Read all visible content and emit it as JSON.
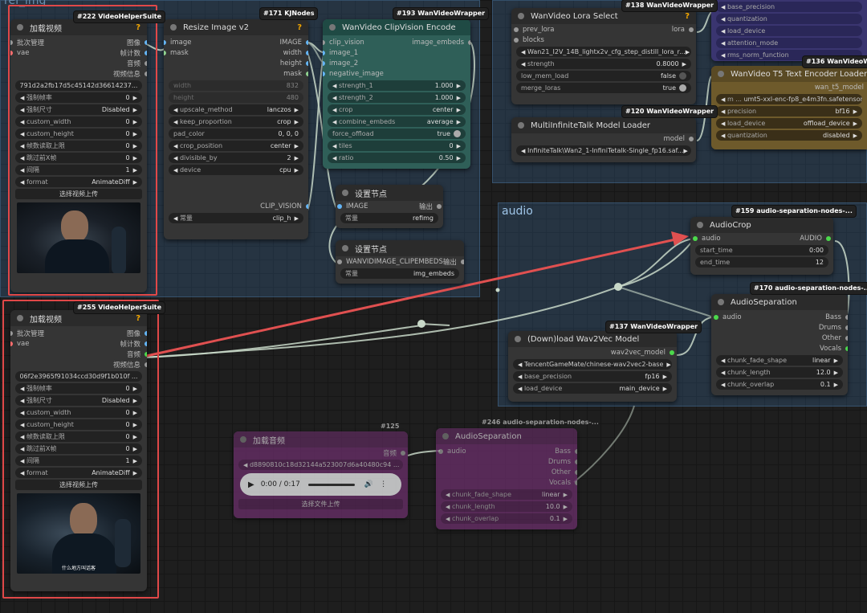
{
  "groups": {
    "ref_img": "ref_img",
    "audio": "audio"
  },
  "node222": {
    "badge_id": "#222",
    "badge_name": "VideoHelperSuite",
    "title": "加载视频",
    "q": "?",
    "in_batch": "批次管理",
    "in_vae": "vae",
    "out_image": "图像",
    "out_frames": "帧计数",
    "out_audio": "音频",
    "out_info": "视频信息",
    "file": "791d2a2fb17d5c45142d3661423​7...",
    "rows": [
      {
        "label": "强制帧率",
        "value": "0"
      },
      {
        "label": "强制尺寸",
        "value": "Disabled"
      },
      {
        "label": "custom_width",
        "value": "0"
      },
      {
        "label": "custom_height",
        "value": "0"
      },
      {
        "label": "帧数读取上限",
        "value": "0"
      },
      {
        "label": "跳过前X帧",
        "value": "0"
      },
      {
        "label": "间隔",
        "value": "1"
      },
      {
        "label": "format",
        "value": "AnimateDiff"
      }
    ],
    "upload": "选择视频上传"
  },
  "node255": {
    "badge_id": "#255",
    "badge_name": "VideoHelperSuite",
    "title": "加载视频",
    "q": "?",
    "in_batch": "批次管理",
    "in_vae": "vae",
    "out_image": "图像",
    "out_frames": "帧计数",
    "out_audio": "音频",
    "out_info": "视频信息",
    "file": "06f2e3965f91034ccd30d9f1b010f ...",
    "rows": [
      {
        "label": "强制帧率",
        "value": "0"
      },
      {
        "label": "强制尺寸",
        "value": "Disabled"
      },
      {
        "label": "custom_width",
        "value": "0"
      },
      {
        "label": "custom_height",
        "value": "0"
      },
      {
        "label": "帧数读取上限",
        "value": "0"
      },
      {
        "label": "跳过前X帧",
        "value": "0"
      },
      {
        "label": "间隔",
        "value": "1"
      },
      {
        "label": "format",
        "value": "AnimateDiff"
      }
    ],
    "upload": "选择视频上传",
    "subtitle": "什么地方叫话客"
  },
  "node171": {
    "badge_id": "#171",
    "badge_name": "KJNodes",
    "title": "Resize Image v2",
    "q": "?",
    "in_image": "image",
    "in_mask": "mask",
    "out_image": "IMAGE",
    "out_width": "width",
    "out_height": "height",
    "out_mask": "mask",
    "width_label": "width",
    "width_val": "832",
    "height_label": "height",
    "height_val": "480",
    "rows": [
      {
        "label": "upscale_method",
        "value": "lanczos"
      },
      {
        "label": "keep_proportion",
        "value": "crop"
      },
      {
        "label": "pad_color",
        "value": "0, 0, 0"
      },
      {
        "label": "crop_position",
        "value": "center"
      },
      {
        "label": "divisible_by",
        "value": "2"
      },
      {
        "label": "device",
        "value": "cpu"
      }
    ],
    "out_clip": "CLIP_VISION",
    "const_label": "常量",
    "const_val": "clip_h"
  },
  "node193": {
    "badge_id": "#193",
    "badge_name": "WanVideoWrapper",
    "title": "WanVideo ClipVision Encode",
    "inputs": [
      "clip_vision",
      "image_1",
      "image_2",
      "negative_image"
    ],
    "out": "image_embeds",
    "rows": [
      {
        "label": "strength_1",
        "value": "1.000"
      },
      {
        "label": "strength_2",
        "value": "1.000"
      },
      {
        "label": "crop",
        "value": "center"
      },
      {
        "label": "combine_embeds",
        "value": "average"
      },
      {
        "label": "force_offload",
        "value": "true"
      },
      {
        "label": "tiles",
        "value": "0"
      },
      {
        "label": "ratio",
        "value": "0.50"
      }
    ]
  },
  "setnode1": {
    "title": "设置节点",
    "in": "IMAGE",
    "out": "输出",
    "const": "常量",
    "val": "refimg"
  },
  "setnode2": {
    "title": "设置节点",
    "in": "WANVIDIMAGE_CLIPEMBEDS",
    "out": "输出",
    "const": "常量",
    "val": "img_embeds"
  },
  "node138": {
    "badge_id": "#138",
    "badge_name": "WanVideoWrapper",
    "title": "WanVideo Lora Select",
    "q": "?",
    "in1": "prev_lora",
    "in2": "blocks",
    "out": "lora",
    "lora_file": "Wan21_I2V_14B_lightx2v_cfg_step_distill_lora_r...",
    "rows": [
      {
        "label": "strength",
        "value": "0.8000"
      },
      {
        "label": "low_mem_load",
        "value": "false"
      },
      {
        "label": "merge_loras",
        "value": "true"
      }
    ]
  },
  "node120": {
    "badge_id": "#120",
    "badge_name": "WanVideoWrapper",
    "title": "MultiInfiniteTalk Model Loader",
    "out": "model",
    "file": "InfiniteTalk\\Wan2_1-InfiniTetalk-Single_fp16.saf..."
  },
  "node_topright": {
    "badge_id": "#138",
    "badge_name": "WanVideoWrapper",
    "rows": [
      "base_precision",
      "quantization",
      "load_device",
      "attention_mode",
      "rms_norm_function"
    ]
  },
  "node136": {
    "badge_id": "#136",
    "badge_name": "WanVideoWrapper",
    "title": "WanVideo T5 Text Encoder Loader",
    "out": "wan_t5_model",
    "file": "umt5-xxl-enc-fp8_e4m3fn.safetensors",
    "rows": [
      {
        "label": "precision",
        "value": "bf16"
      },
      {
        "label": "load_device",
        "value": "offload_device"
      },
      {
        "label": "quantization",
        "value": "disabled"
      }
    ]
  },
  "node159": {
    "badge_id": "#159",
    "badge_name": "audio-separation-nodes-...",
    "title": "AudioCrop",
    "in": "audio",
    "out": "AUDIO",
    "rows": [
      {
        "label": "start_time",
        "value": "0:00"
      },
      {
        "label": "end_time",
        "value": "12"
      }
    ]
  },
  "node170": {
    "badge_id": "#170",
    "badge_name": "audio-separation-nodes-...",
    "title": "AudioSeparation",
    "in": "audio",
    "outs": [
      "Bass",
      "Drums",
      "Other",
      "Vocals"
    ],
    "rows": [
      {
        "label": "chunk_fade_shape",
        "value": "linear"
      },
      {
        "label": "chunk_length",
        "value": "12.0"
      },
      {
        "label": "chunk_overlap",
        "value": "0.1"
      }
    ]
  },
  "node137": {
    "badge_id": "#137",
    "badge_name": "WanVideoWrapper",
    "title": "(Down)load Wav2Vec Model",
    "out": "wav2vec_model",
    "rows": [
      {
        "label": "",
        "value": "TencentGameMate/chinese-wav2vec2-base"
      },
      {
        "label": "base_precision",
        "value": "fp16"
      },
      {
        "label": "load_device",
        "value": "main_device"
      }
    ]
  },
  "node125": {
    "badge_id": "#125",
    "title": "加载音频",
    "out": "音频",
    "file": "d8890810c18d32144a523007d6a40480c94 ...",
    "time": "0:00 / 0:17",
    "upload": "选择文件上传"
  },
  "node246": {
    "badge_id": "#246",
    "badge_name": "audio-separation-nodes-...",
    "title": "AudioSeparation",
    "in": "audio",
    "outs": [
      "Bass",
      "Drums",
      "Other",
      "Vocals"
    ],
    "rows": [
      {
        "label": "chunk_fade_shape",
        "value": "linear"
      },
      {
        "label": "chunk_length",
        "value": "10.0"
      },
      {
        "label": "chunk_overlap",
        "value": "0.1"
      }
    ]
  },
  "colors": {
    "highlight": "#e04848",
    "link": "#c8d8c8",
    "arrow": "#e05050"
  }
}
